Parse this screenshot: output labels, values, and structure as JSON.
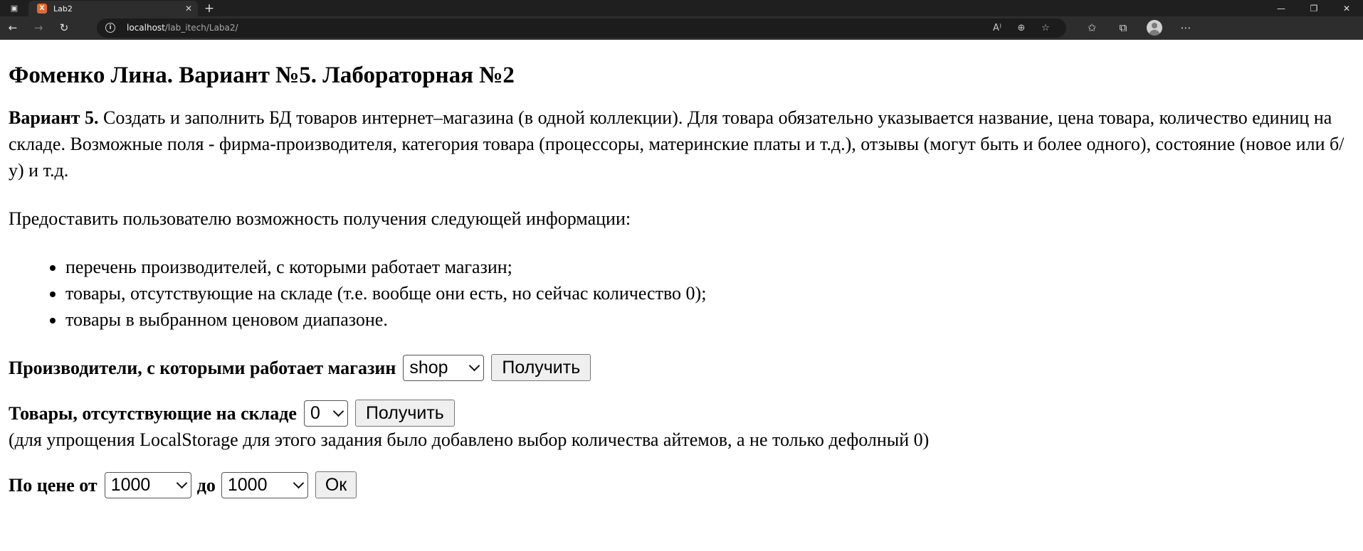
{
  "browser": {
    "tab_title": "Lab2",
    "favicon_letter": "X",
    "url_host": "localhost",
    "url_path": "/lab_itech/Laba2/"
  },
  "page": {
    "heading": "Фоменко Лина. Вариант №5. Лабораторная №2",
    "variant_label": "Вариант 5.",
    "variant_text": " Создать и заполнить БД товаров интернет–магазина (в одной коллекции). Для товара обязательно указывается название, цена товара, количество единиц на складе. Возможные поля - фирма-производителя, категория товара (процессоры, материнские платы и т.д.), отзывы (могут быть и более одного), состояние (новое или б/у) и т.д.",
    "provide_text": "Предоставить пользователю возможность получения следующей информации:",
    "list": [
      "перечень производителей, с которыми работает магазин;",
      "товары, отсутствующие на складе (т.е. вообще они есть, но сейчас количество 0);",
      "товары в выбранном ценовом диапазоне."
    ]
  },
  "forms": {
    "producers": {
      "label": "Производители, с которыми работает магазин",
      "select_value": "shop",
      "button": "Получить"
    },
    "out_of_stock": {
      "label": "Товары, отсутствующие на складе",
      "select_value": "0",
      "button": "Получить",
      "note": "(для упрощения LocalStorage для этого задания было добавлено выбор количества айтемов, а не только дефолный 0)"
    },
    "price": {
      "label_from": "По цене от",
      "from_value": "1000",
      "label_to": "до",
      "to_value": "1000",
      "button": "Ок"
    }
  }
}
